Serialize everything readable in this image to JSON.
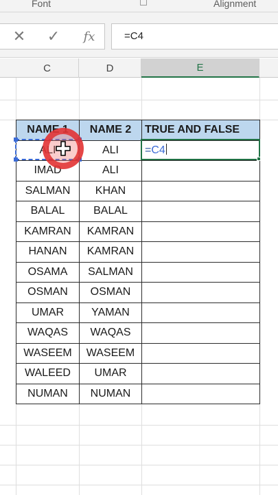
{
  "ribbon": {
    "font_group": "Font",
    "alignment_group": "Alignment"
  },
  "formula_bar": {
    "cancel_icon": "✕",
    "enter_icon": "✓",
    "fx_label": "fx",
    "value": "=C4"
  },
  "columns": [
    "C",
    "D",
    "E"
  ],
  "table": {
    "headers": [
      "NAME 1",
      "NAME 2",
      "TRUE AND FALSE"
    ],
    "rows": [
      [
        "ALI",
        "ALI"
      ],
      [
        "IMAD",
        "ALI"
      ],
      [
        "SALMAN",
        "KHAN"
      ],
      [
        "BALAL",
        "BALAL"
      ],
      [
        "KAMRAN",
        "KAMRAN"
      ],
      [
        "HANAN",
        "KAMRAN"
      ],
      [
        "OSAMA",
        "SALMAN"
      ],
      [
        "OSMAN",
        "OSMAN"
      ],
      [
        "UMAR",
        "YAMAN"
      ],
      [
        "WAQAS",
        "WAQAS"
      ],
      [
        "WASEEM",
        "WASEEM"
      ],
      [
        "WALEED",
        "UMAR"
      ],
      [
        "NUMAN",
        "NUMAN"
      ]
    ],
    "active_formula_prefix": "=",
    "active_formula_ref": "C4"
  },
  "colors": {
    "header_fill": "#bdd7ee",
    "selection": "#217346",
    "reference": "#3b6bd6",
    "click_ring": "#e23030"
  },
  "icons": {
    "cancel": "close-icon",
    "enter": "check-icon",
    "function": "fx-icon",
    "cursor": "move-cursor-icon"
  }
}
